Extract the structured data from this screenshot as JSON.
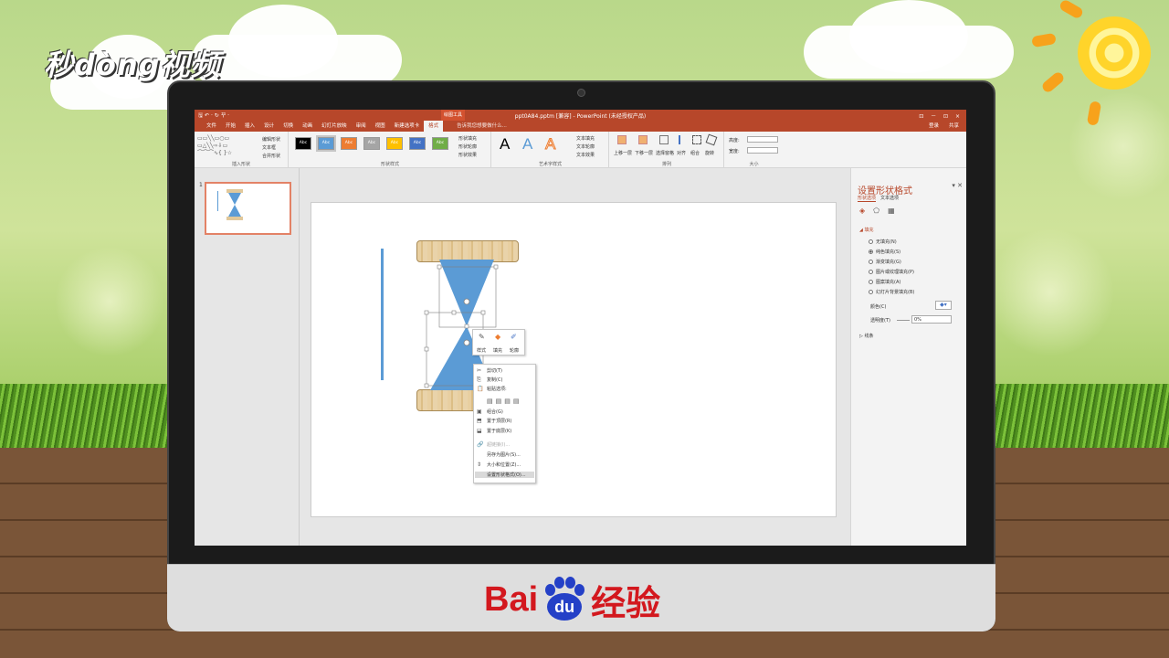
{
  "watermark": {
    "top_logo": "秒dòng视频",
    "bottom_brand_a": "Bai",
    "bottom_brand_paw": "du",
    "bottom_brand_b": "经验"
  },
  "app": {
    "title": "ppt0A84.pptm [兼容] - PowerPoint (未经授权产品)",
    "context_tab_group": "绘图工具",
    "quick_icons": "🖫 ↶ · ↻ 꾸 ·",
    "window_controls": "⊡ － ⊡ ×",
    "accent": "#b7472a"
  },
  "tabs": {
    "items": [
      "文件",
      "开始",
      "插入",
      "设计",
      "切换",
      "动画",
      "幻灯片放映",
      "审阅",
      "视图",
      "新建选项卡",
      "格式"
    ],
    "active": "格式",
    "search": "告诉我您想要做什么...",
    "login": "登录",
    "share": "共享"
  },
  "ribbon": {
    "insert_shapes": {
      "label": "插入形状",
      "edit_shape": "编辑形状",
      "textbox": "文本框",
      "merge": "合并形状"
    },
    "shape_styles": {
      "label": "形状样式",
      "swatch_text": "Abc",
      "swatches": [
        "#000000",
        "#5b9bd5",
        "#ed7d31",
        "#a5a5a5",
        "#ffc000",
        "#4472c4",
        "#70ad47"
      ],
      "fill": "形状填充",
      "outline": "形状轮廓",
      "effect": "形状效果"
    },
    "wordart": {
      "label": "艺术字样式",
      "letter": "A",
      "text_fill": "文本填充",
      "text_outline": "文本轮廓",
      "text_effect": "文本效果"
    },
    "arrange": {
      "label": "排列",
      "forward": "上移一层",
      "backward": "下移一层",
      "selection": "选择窗格",
      "align": "对齐",
      "group": "组合",
      "rotate": "旋转"
    },
    "size": {
      "label": "大小",
      "height": "高度:",
      "width": "宽度:"
    }
  },
  "thumbs": {
    "slide_number": "1"
  },
  "mini_toolbar": {
    "style": "样式",
    "fill": "填充",
    "outline": "轮廓"
  },
  "context_menu": {
    "items": [
      {
        "label": "剪切(T)",
        "disabled": false
      },
      {
        "label": "复制(C)",
        "disabled": false
      },
      {
        "label": "粘贴选项:",
        "disabled": false
      },
      {
        "label": "组合(G)",
        "disabled": false
      },
      {
        "label": "置于顶层(R)",
        "disabled": false
      },
      {
        "label": "置于底层(K)",
        "disabled": false
      },
      {
        "label": "超链接(I)...",
        "disabled": true
      },
      {
        "label": "另存为图片(S)...",
        "disabled": false
      },
      {
        "label": "大小和位置(Z)...",
        "disabled": false
      },
      {
        "label": "设置形状格式(O)...",
        "disabled": false
      }
    ]
  },
  "format_pane": {
    "title": "设置形状格式",
    "subtab_shape": "形状选项",
    "subtab_text": "文本选项",
    "fill_section": "填充",
    "fill_options": [
      "无填充(N)",
      "纯色填充(S)",
      "渐变填充(G)",
      "图片或纹理填充(P)",
      "图案填充(A)",
      "幻灯片背景填充(B)"
    ],
    "fill_selected": "纯色填充(S)",
    "color_label": "颜色(C)",
    "transparency_label": "透明度(T)",
    "transparency_value": "0%",
    "line_section": "线条"
  },
  "colors": {
    "shape_blue": "#5b9bd5",
    "handle": "#7f7f7f"
  }
}
